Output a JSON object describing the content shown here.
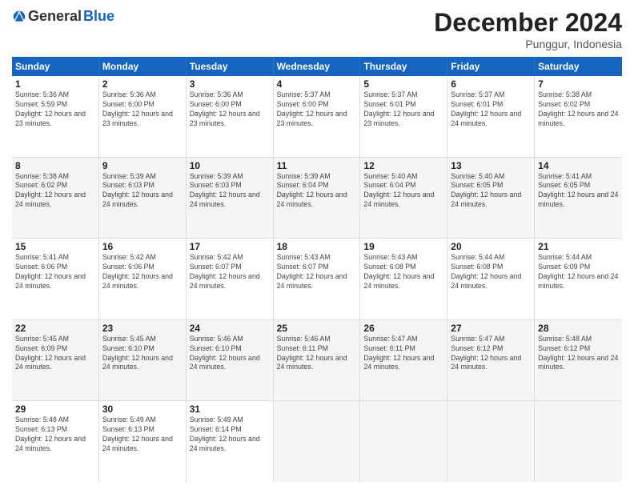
{
  "logo": {
    "general": "General",
    "blue": "Blue"
  },
  "title": "December 2024",
  "location": "Punggur, Indonesia",
  "weekdays": [
    "Sunday",
    "Monday",
    "Tuesday",
    "Wednesday",
    "Thursday",
    "Friday",
    "Saturday"
  ],
  "weeks": [
    [
      {
        "day": "1",
        "sunrise": "Sunrise: 5:36 AM",
        "sunset": "Sunset: 5:59 PM",
        "daylight": "Daylight: 12 hours and 23 minutes."
      },
      {
        "day": "2",
        "sunrise": "Sunrise: 5:36 AM",
        "sunset": "Sunset: 6:00 PM",
        "daylight": "Daylight: 12 hours and 23 minutes."
      },
      {
        "day": "3",
        "sunrise": "Sunrise: 5:36 AM",
        "sunset": "Sunset: 6:00 PM",
        "daylight": "Daylight: 12 hours and 23 minutes."
      },
      {
        "day": "4",
        "sunrise": "Sunrise: 5:37 AM",
        "sunset": "Sunset: 6:00 PM",
        "daylight": "Daylight: 12 hours and 23 minutes."
      },
      {
        "day": "5",
        "sunrise": "Sunrise: 5:37 AM",
        "sunset": "Sunset: 6:01 PM",
        "daylight": "Daylight: 12 hours and 23 minutes."
      },
      {
        "day": "6",
        "sunrise": "Sunrise: 5:37 AM",
        "sunset": "Sunset: 6:01 PM",
        "daylight": "Daylight: 12 hours and 24 minutes."
      },
      {
        "day": "7",
        "sunrise": "Sunrise: 5:38 AM",
        "sunset": "Sunset: 6:02 PM",
        "daylight": "Daylight: 12 hours and 24 minutes."
      }
    ],
    [
      {
        "day": "8",
        "sunrise": "Sunrise: 5:38 AM",
        "sunset": "Sunset: 6:02 PM",
        "daylight": "Daylight: 12 hours and 24 minutes."
      },
      {
        "day": "9",
        "sunrise": "Sunrise: 5:39 AM",
        "sunset": "Sunset: 6:03 PM",
        "daylight": "Daylight: 12 hours and 24 minutes."
      },
      {
        "day": "10",
        "sunrise": "Sunrise: 5:39 AM",
        "sunset": "Sunset: 6:03 PM",
        "daylight": "Daylight: 12 hours and 24 minutes."
      },
      {
        "day": "11",
        "sunrise": "Sunrise: 5:39 AM",
        "sunset": "Sunset: 6:04 PM",
        "daylight": "Daylight: 12 hours and 24 minutes."
      },
      {
        "day": "12",
        "sunrise": "Sunrise: 5:40 AM",
        "sunset": "Sunset: 6:04 PM",
        "daylight": "Daylight: 12 hours and 24 minutes."
      },
      {
        "day": "13",
        "sunrise": "Sunrise: 5:40 AM",
        "sunset": "Sunset: 6:05 PM",
        "daylight": "Daylight: 12 hours and 24 minutes."
      },
      {
        "day": "14",
        "sunrise": "Sunrise: 5:41 AM",
        "sunset": "Sunset: 6:05 PM",
        "daylight": "Daylight: 12 hours and 24 minutes."
      }
    ],
    [
      {
        "day": "15",
        "sunrise": "Sunrise: 5:41 AM",
        "sunset": "Sunset: 6:06 PM",
        "daylight": "Daylight: 12 hours and 24 minutes."
      },
      {
        "day": "16",
        "sunrise": "Sunrise: 5:42 AM",
        "sunset": "Sunset: 6:06 PM",
        "daylight": "Daylight: 12 hours and 24 minutes."
      },
      {
        "day": "17",
        "sunrise": "Sunrise: 5:42 AM",
        "sunset": "Sunset: 6:07 PM",
        "daylight": "Daylight: 12 hours and 24 minutes."
      },
      {
        "day": "18",
        "sunrise": "Sunrise: 5:43 AM",
        "sunset": "Sunset: 6:07 PM",
        "daylight": "Daylight: 12 hours and 24 minutes."
      },
      {
        "day": "19",
        "sunrise": "Sunrise: 5:43 AM",
        "sunset": "Sunset: 6:08 PM",
        "daylight": "Daylight: 12 hours and 24 minutes."
      },
      {
        "day": "20",
        "sunrise": "Sunrise: 5:44 AM",
        "sunset": "Sunset: 6:08 PM",
        "daylight": "Daylight: 12 hours and 24 minutes."
      },
      {
        "day": "21",
        "sunrise": "Sunrise: 5:44 AM",
        "sunset": "Sunset: 6:09 PM",
        "daylight": "Daylight: 12 hours and 24 minutes."
      }
    ],
    [
      {
        "day": "22",
        "sunrise": "Sunrise: 5:45 AM",
        "sunset": "Sunset: 6:09 PM",
        "daylight": "Daylight: 12 hours and 24 minutes."
      },
      {
        "day": "23",
        "sunrise": "Sunrise: 5:45 AM",
        "sunset": "Sunset: 6:10 PM",
        "daylight": "Daylight: 12 hours and 24 minutes."
      },
      {
        "day": "24",
        "sunrise": "Sunrise: 5:46 AM",
        "sunset": "Sunset: 6:10 PM",
        "daylight": "Daylight: 12 hours and 24 minutes."
      },
      {
        "day": "25",
        "sunrise": "Sunrise: 5:46 AM",
        "sunset": "Sunset: 6:11 PM",
        "daylight": "Daylight: 12 hours and 24 minutes."
      },
      {
        "day": "26",
        "sunrise": "Sunrise: 5:47 AM",
        "sunset": "Sunset: 6:11 PM",
        "daylight": "Daylight: 12 hours and 24 minutes."
      },
      {
        "day": "27",
        "sunrise": "Sunrise: 5:47 AM",
        "sunset": "Sunset: 6:12 PM",
        "daylight": "Daylight: 12 hours and 24 minutes."
      },
      {
        "day": "28",
        "sunrise": "Sunrise: 5:48 AM",
        "sunset": "Sunset: 6:12 PM",
        "daylight": "Daylight: 12 hours and 24 minutes."
      }
    ],
    [
      {
        "day": "29",
        "sunrise": "Sunrise: 5:48 AM",
        "sunset": "Sunset: 6:13 PM",
        "daylight": "Daylight: 12 hours and 24 minutes."
      },
      {
        "day": "30",
        "sunrise": "Sunrise: 5:49 AM",
        "sunset": "Sunset: 6:13 PM",
        "daylight": "Daylight: 12 hours and 24 minutes."
      },
      {
        "day": "31",
        "sunrise": "Sunrise: 5:49 AM",
        "sunset": "Sunset: 6:14 PM",
        "daylight": "Daylight: 12 hours and 24 minutes."
      },
      null,
      null,
      null,
      null
    ]
  ]
}
